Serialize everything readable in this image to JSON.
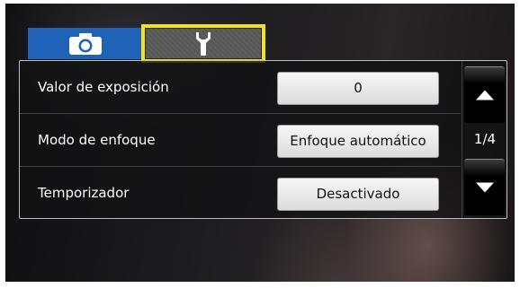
{
  "tabs": [
    {
      "icon": "camera-icon",
      "active": true
    },
    {
      "icon": "wrench-icon",
      "active": false,
      "highlighted": true
    }
  ],
  "settings": [
    {
      "label": "Valor de exposición",
      "value": "0"
    },
    {
      "label": "Modo de enfoque",
      "value": "Enfoque automático"
    },
    {
      "label": "Temporizador",
      "value": "Desactivado"
    }
  ],
  "pagination": {
    "indicator": "1/4"
  },
  "colors": {
    "active_tab": "#1e63b8",
    "highlight": "#f5e21c"
  }
}
